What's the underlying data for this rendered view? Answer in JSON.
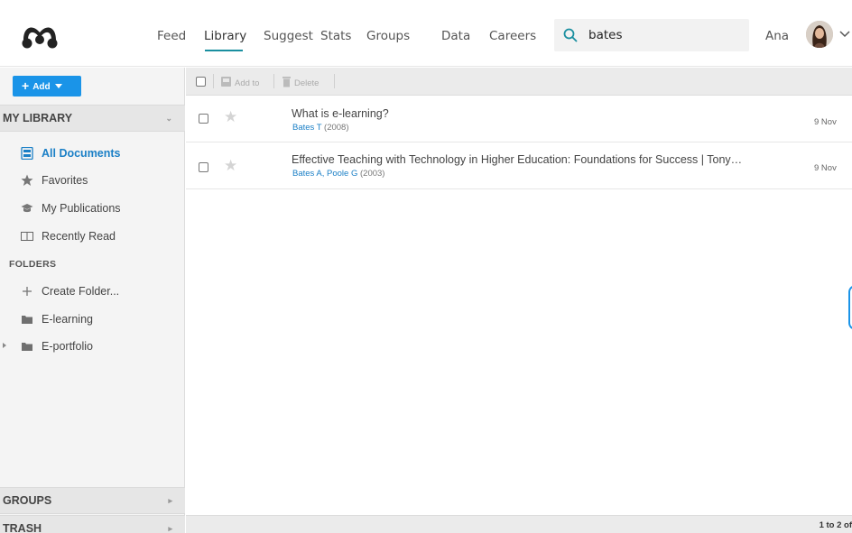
{
  "nav": {
    "items": [
      "Feed",
      "Library",
      "Suggest",
      "Stats",
      "Groups",
      "Data",
      "Careers"
    ],
    "active": "Library",
    "search_value": "bates",
    "user_name": "Ana"
  },
  "sidebar": {
    "add_label": "Add",
    "my_library": "MY LIBRARY",
    "library_items": [
      {
        "label": "All Documents",
        "icon": "documents-icon",
        "active": true
      },
      {
        "label": "Favorites",
        "icon": "star-icon"
      },
      {
        "label": "My Publications",
        "icon": "graduation-cap-icon"
      },
      {
        "label": "Recently Read",
        "icon": "open-book-icon"
      }
    ],
    "folders_label": "FOLDERS",
    "folders": [
      {
        "label": "Create Folder...",
        "icon": "plus-icon"
      },
      {
        "label": "E-learning",
        "icon": "folder-icon"
      },
      {
        "label": "E-portfolio",
        "icon": "folder-icon",
        "has_children": true
      }
    ],
    "groups": "GROUPS",
    "trash": "TRASH"
  },
  "toolbar": {
    "add_to": "Add to",
    "delete": "Delete"
  },
  "documents": [
    {
      "title": "What is e-learning?",
      "authors": "Bates T",
      "year": "(2008)",
      "date": "9 Nov"
    },
    {
      "title": "Effective Teaching with Technology in Higher Education: Foundations for Success | Tony…",
      "authors": "Bates A, Poole G",
      "year": "(2003)",
      "date": "9 Nov"
    }
  ],
  "footer": {
    "pager": "1 to 2 of"
  },
  "colors": {
    "accent": "#1a8fa0",
    "primary_button": "#1a94e8",
    "link": "#1a7fc6"
  }
}
